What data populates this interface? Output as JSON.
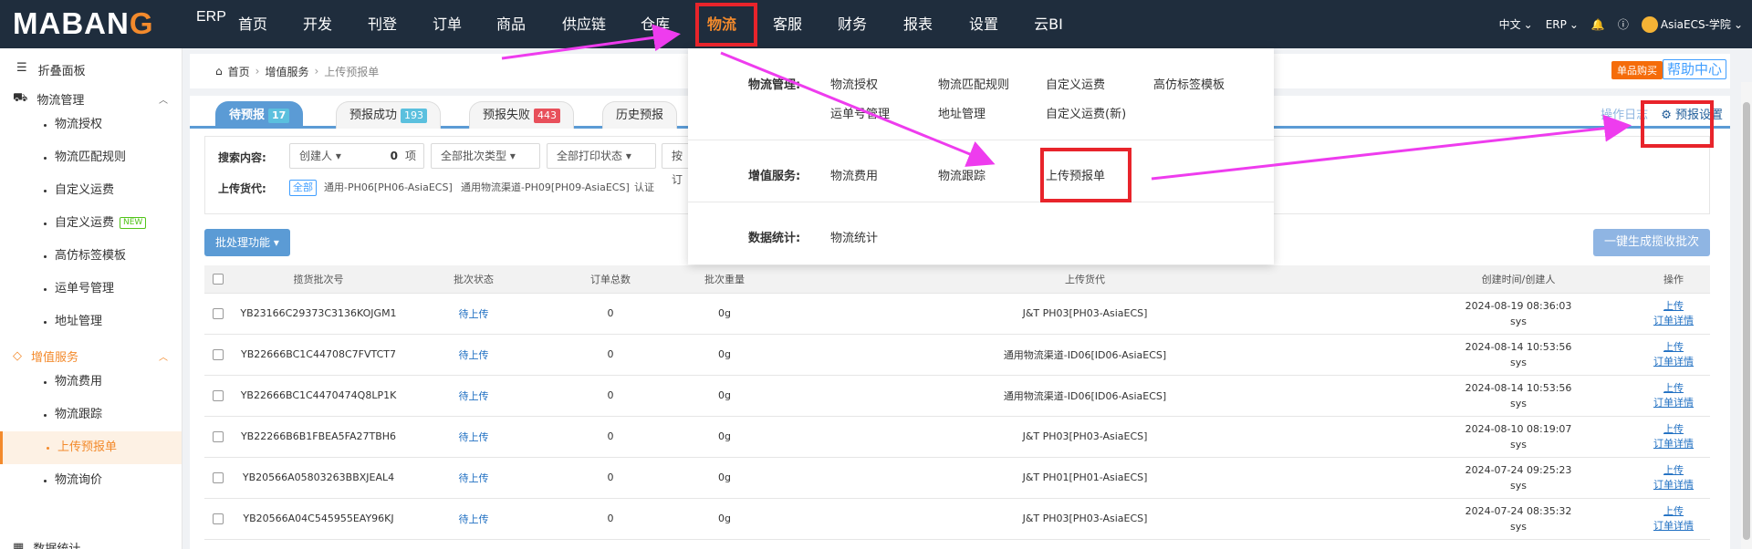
{
  "logo": {
    "text_main": "MABAN",
    "text_o": "G",
    "erp": "ERP"
  },
  "nav": {
    "items": [
      {
        "label": "首页"
      },
      {
        "label": "开发"
      },
      {
        "label": "刊登"
      },
      {
        "label": "订单"
      },
      {
        "label": "商品"
      },
      {
        "label": "供应链"
      },
      {
        "label": "仓库"
      },
      {
        "label": "物流"
      },
      {
        "label": "客服"
      },
      {
        "label": "财务"
      },
      {
        "label": "报表"
      },
      {
        "label": "设置"
      },
      {
        "label": "云BI"
      }
    ],
    "active": "物流",
    "lang": "中文",
    "system": "ERP",
    "user": "AsiaECS-学院"
  },
  "sidebar": {
    "collapse_label": "折叠面板",
    "groups": [
      {
        "label": "物流管理",
        "items": [
          "物流授权",
          "物流匹配规则",
          "自定义运费",
          "自定义运费",
          "高仿标签模板",
          "运单号管理",
          "地址管理"
        ]
      },
      {
        "label": "增值服务",
        "items": [
          "物流费用",
          "物流跟踪",
          "上传预报单",
          "物流询价"
        ]
      },
      {
        "label": "数据统计",
        "items": []
      }
    ],
    "new_badge": "NEW",
    "active_item": "上传预报单"
  },
  "breadcrumb": {
    "home": "首页",
    "level1": "增值服务",
    "current": "上传预报单"
  },
  "header_buttons": {
    "buy": "单品购买",
    "help": "帮助中心"
  },
  "tabs": [
    {
      "label": "待预报",
      "count": "17",
      "color": "#5bc0de"
    },
    {
      "label": "预报成功",
      "count": "193",
      "color": "#5bc0de"
    },
    {
      "label": "预报失败",
      "count": "443",
      "color": "#e8505b"
    },
    {
      "label": "历史预报",
      "count": "",
      "color": "#5bc0de"
    }
  ],
  "ops": {
    "log": "操作日志",
    "settings": "预报设置"
  },
  "search": {
    "label": "搜索内容:",
    "creator": "创建人",
    "count": "0",
    "count_unit": "项",
    "batch_type": "全部批次类型",
    "print_status": "全部打印状态",
    "more": "按订"
  },
  "carrier": {
    "label": "上传货代:",
    "all": "全部",
    "options": [
      "通用-PH06[PH06-AsiaECS]",
      "通用物流渠道-PH09[PH09-AsiaECS]",
      "认证"
    ]
  },
  "buttons": {
    "batch": "批处理功能",
    "generate": "一键生成揽收批次"
  },
  "table": {
    "headers": [
      "揽货批次号",
      "批次状态",
      "订单总数",
      "批次重量",
      "上传货代",
      "创建时间/创建人",
      "操作"
    ],
    "rows": [
      {
        "batch": "YB23166C29373C3136KOJGM1",
        "status": "待上传",
        "orders": "0",
        "weight": "0g",
        "carrier": "J&T PH03[PH03-AsiaECS]",
        "time": "2024-08-19 08:36:03",
        "user": "sys"
      },
      {
        "batch": "YB22666BC1C44708C7FVTCT7",
        "status": "待上传",
        "orders": "0",
        "weight": "0g",
        "carrier": "通用物流渠道-ID06[ID06-AsiaECS]",
        "time": "2024-08-14 10:53:56",
        "user": "sys"
      },
      {
        "batch": "YB22666BC1C4470474Q8LP1K",
        "status": "待上传",
        "orders": "0",
        "weight": "0g",
        "carrier": "通用物流渠道-ID06[ID06-AsiaECS]",
        "time": "2024-08-14 10:53:56",
        "user": "sys"
      },
      {
        "batch": "YB22266B6B1FBEA5FA27TBH6",
        "status": "待上传",
        "orders": "0",
        "weight": "0g",
        "carrier": "J&T PH03[PH03-AsiaECS]",
        "time": "2024-08-10 08:19:07",
        "user": "sys"
      },
      {
        "batch": "YB20566A05803263BBXJEAL4",
        "status": "待上传",
        "orders": "0",
        "weight": "0g",
        "carrier": "J&T PH01[PH01-AsiaECS]",
        "time": "2024-07-24 09:25:23",
        "user": "sys"
      },
      {
        "batch": "YB20566A04C545955EAY96KJ",
        "status": "待上传",
        "orders": "0",
        "weight": "0g",
        "carrier": "J&T PH03[PH03-AsiaECS]",
        "time": "2024-07-24 08:35:32",
        "user": "sys"
      }
    ],
    "action_upload": "上传",
    "action_detail": "订单详情"
  },
  "dropdown": {
    "sections": [
      {
        "label": "物流管理:",
        "links": [
          "物流授权",
          "物流匹配规则",
          "自定义运费",
          "高仿标签模板",
          "运单号管理",
          "地址管理",
          "自定义运费(新)"
        ]
      },
      {
        "label": "增值服务:",
        "links": [
          "物流费用",
          "物流跟踪",
          "上传预报单"
        ]
      },
      {
        "label": "数据统计:",
        "links": [
          "物流统计"
        ]
      }
    ]
  },
  "colors": {
    "nav_bg": "#1f2d3d",
    "accent": "#f38a2c",
    "tab_blue": "#5b9bd5",
    "annotation_red": "#e8242b",
    "annotation_arrow": "#ee3cee"
  }
}
